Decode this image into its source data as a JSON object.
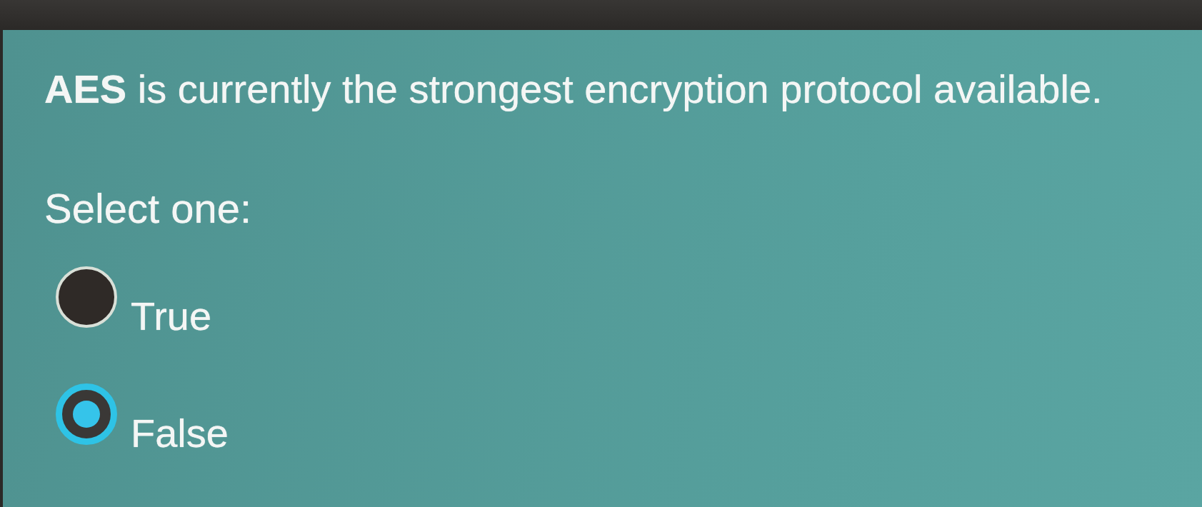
{
  "question": {
    "text": "**AES** is currently the strongest encryption protocol available."
  },
  "prompt": "Select one:",
  "options": [
    {
      "label": "True",
      "selected": false
    },
    {
      "label": "False",
      "selected": true
    }
  ]
}
